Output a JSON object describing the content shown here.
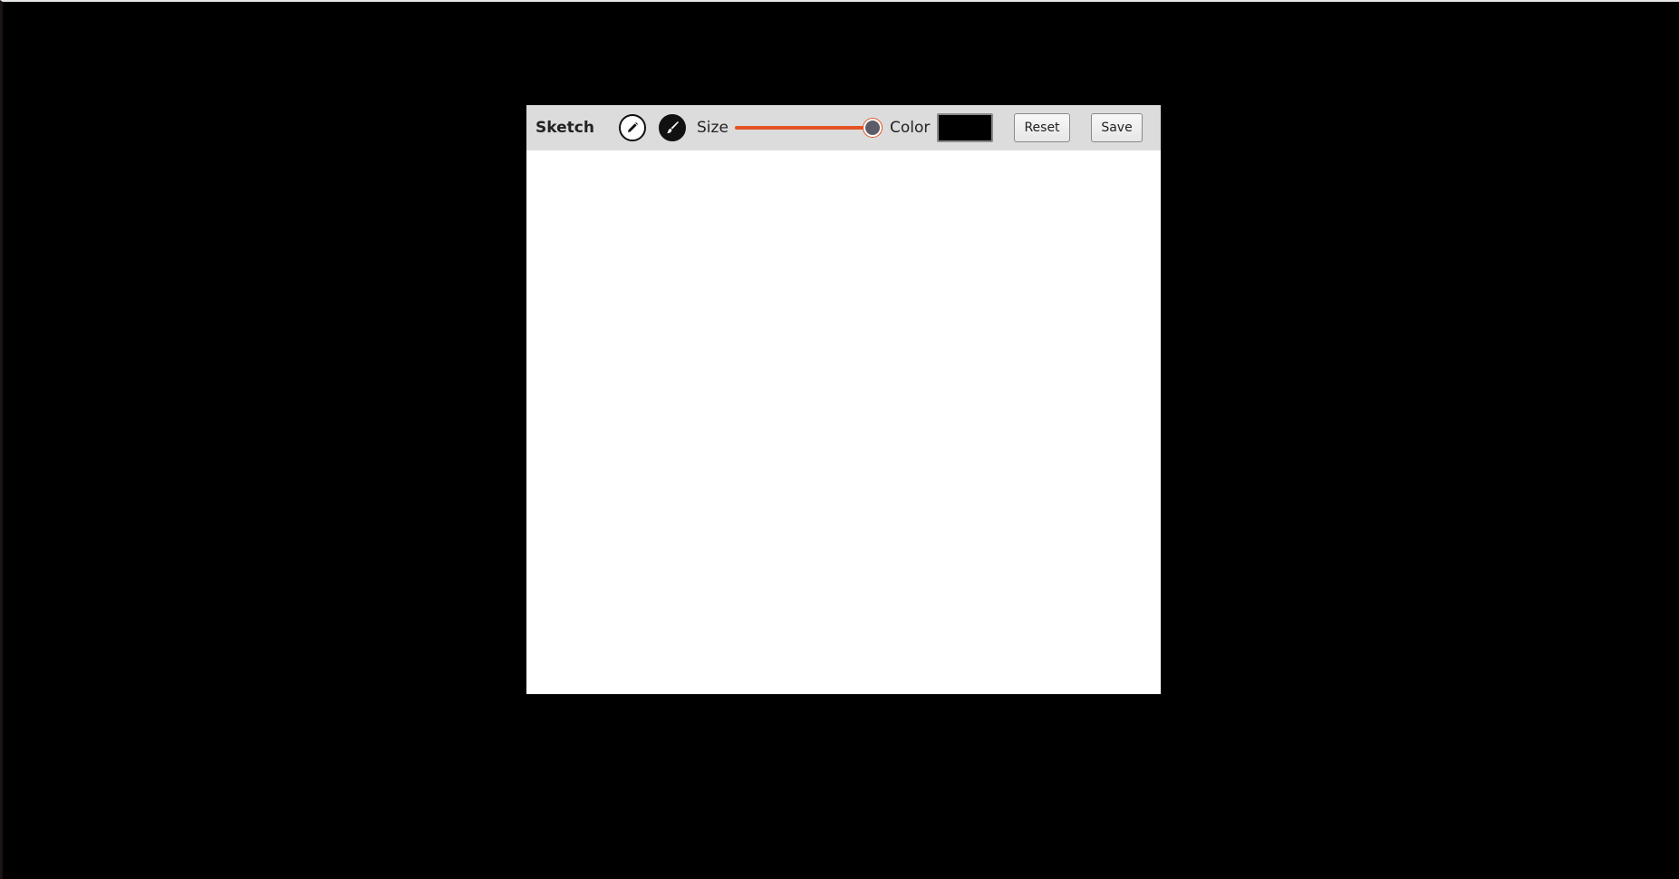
{
  "app": {
    "title": "Sketch"
  },
  "toolbar": {
    "tools": [
      {
        "name": "pencil",
        "icon": "pencil-icon",
        "active": false
      },
      {
        "name": "brush",
        "icon": "brush-icon",
        "active": true
      }
    ],
    "size_label": "Size",
    "size_value_fraction": 0.95,
    "color_label": "Color",
    "color_value": "#000000",
    "reset_label": "Reset",
    "save_label": "Save"
  },
  "colors": {
    "background": "#000000",
    "toolbar": "#dcdcdc",
    "canvas": "#ffffff",
    "slider_accent": "#e25424",
    "slider_thumb": "#5c5c69"
  }
}
